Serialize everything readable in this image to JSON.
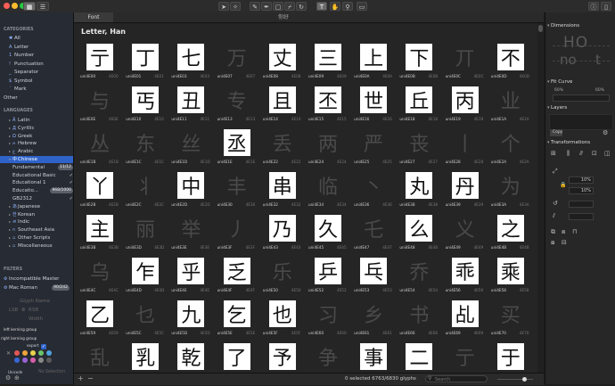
{
  "tabs": [
    {
      "label": "Font"
    },
    {
      "label": "你好"
    }
  ],
  "sidebar": {
    "categories_head": "CATEGORIES",
    "categories": [
      {
        "label": "All",
        "icon": "asterisk"
      },
      {
        "label": "Letter",
        "icon": "A"
      },
      {
        "label": "Number",
        "icon": "1"
      },
      {
        "label": "Punctuation",
        "icon": "!"
      },
      {
        "label": "Separator",
        "icon": "_"
      },
      {
        "label": "Symbol",
        "icon": "$"
      },
      {
        "label": "Mark",
        "icon": "´"
      },
      {
        "label": "Other",
        "icon": ""
      }
    ],
    "languages_head": "LANGUAGES",
    "languages": [
      {
        "label": "Latin",
        "icon": "Ä"
      },
      {
        "label": "Cyrillic",
        "icon": "Д"
      },
      {
        "label": "Greek",
        "icon": "Ω"
      },
      {
        "label": "Hebrew",
        "icon": "א"
      },
      {
        "label": "Arabic",
        "icon": "ع"
      },
      {
        "label": "Chinese",
        "icon": "中"
      }
    ],
    "chinese_sub": [
      {
        "label": "Fundamental",
        "badge": "11/12"
      },
      {
        "label": "Educational Basic",
        "check": "✓"
      },
      {
        "label": "Educational 1",
        "check": "✓"
      },
      {
        "label": "Educatio...",
        "badge": "968/1000"
      },
      {
        "label": "GB2312",
        "check": "✓"
      }
    ],
    "languages2": [
      {
        "label": "Japanese",
        "icon": "あ"
      },
      {
        "label": "Korean",
        "icon": "한"
      },
      {
        "label": "Indic",
        "icon": "अ"
      },
      {
        "label": "Southeast Asia",
        "icon": "ก"
      },
      {
        "label": "Other Scripts",
        "icon": ""
      },
      {
        "label": "Miscellaneous",
        "icon": ""
      }
    ],
    "filters_head": "FILTERS",
    "filters": [
      {
        "label": "Incompatible Master"
      },
      {
        "label": "Mac Roman",
        "badge": "90/242"
      }
    ],
    "glyph_name": "Glyph Name",
    "lsb": "LSB",
    "rsb": "RSB",
    "width": "Width",
    "left_kerning": "left kerning group",
    "right_kerning": "right kerning group",
    "export": "export",
    "unicode": "Unicode",
    "no_selection": "No Selection"
  },
  "main": {
    "title": "Letter, Han",
    "glyphs": [
      {
        "ch": "亍",
        "name": "uni4E00",
        "code": "4E00",
        "drawn": true
      },
      {
        "ch": "丁",
        "name": "uni4E01",
        "code": "4E01",
        "drawn": true
      },
      {
        "ch": "七",
        "name": "uni4E03",
        "code": "4E03",
        "drawn": true
      },
      {
        "ch": "万",
        "name": "uni4E07",
        "code": "4E07",
        "drawn": false
      },
      {
        "ch": "丈",
        "name": "uni4E08",
        "code": "4E08",
        "drawn": true
      },
      {
        "ch": "三",
        "name": "uni4E09",
        "code": "4E09",
        "drawn": true
      },
      {
        "ch": "上",
        "name": "uni4E0A",
        "code": "4E0A",
        "drawn": true
      },
      {
        "ch": "下",
        "name": "uni4E0B",
        "code": "4E0B",
        "drawn": true
      },
      {
        "ch": "丌",
        "name": "uni4E0C",
        "code": "4E0C",
        "drawn": false
      },
      {
        "ch": "不",
        "name": "uni4E0D",
        "code": "4E0D",
        "drawn": true
      },
      {
        "ch": "与",
        "name": "uni4E0E",
        "code": "4E0E",
        "drawn": false
      },
      {
        "ch": "丐",
        "name": "uni4E10",
        "code": "4E10",
        "drawn": true
      },
      {
        "ch": "丑",
        "name": "uni4E11",
        "code": "4E11",
        "drawn": true
      },
      {
        "ch": "专",
        "name": "uni4E13",
        "code": "4E13",
        "drawn": false
      },
      {
        "ch": "且",
        "name": "uni4E14",
        "code": "4E14",
        "drawn": true
      },
      {
        "ch": "丕",
        "name": "uni4E15",
        "code": "4E15",
        "drawn": true
      },
      {
        "ch": "世",
        "name": "uni4E16",
        "code": "4E16",
        "drawn": true
      },
      {
        "ch": "丘",
        "name": "uni4E18",
        "code": "4E18",
        "drawn": true
      },
      {
        "ch": "丙",
        "name": "uni4E19",
        "code": "4E19",
        "drawn": true
      },
      {
        "ch": "业",
        "name": "uni4E1A",
        "code": "4E1A",
        "drawn": false
      },
      {
        "ch": "丛",
        "name": "uni4E1B",
        "code": "4E1B",
        "drawn": false
      },
      {
        "ch": "东",
        "name": "uni4E1C",
        "code": "4E1C",
        "drawn": false
      },
      {
        "ch": "丝",
        "name": "uni4E1D",
        "code": "4E1D",
        "drawn": false
      },
      {
        "ch": "丞",
        "name": "uni4E1E",
        "code": "4E1E",
        "drawn": true
      },
      {
        "ch": "丢",
        "name": "uni4E22",
        "code": "4E22",
        "drawn": false
      },
      {
        "ch": "两",
        "name": "uni4E24",
        "code": "4E24",
        "drawn": false
      },
      {
        "ch": "严",
        "name": "uni4E25",
        "code": "4E25",
        "drawn": false
      },
      {
        "ch": "丧",
        "name": "uni4E27",
        "code": "4E27",
        "drawn": false
      },
      {
        "ch": "丨",
        "name": "uni4E28",
        "code": "4E28",
        "drawn": false
      },
      {
        "ch": "个",
        "name": "uni4E2A",
        "code": "4E2A",
        "drawn": false
      },
      {
        "ch": "丫",
        "name": "uni4E2B",
        "code": "4E2B",
        "drawn": true
      },
      {
        "ch": "丬",
        "name": "uni4E2C",
        "code": "4E2C",
        "drawn": false
      },
      {
        "ch": "中",
        "name": "uni4E2D",
        "code": "4E2D",
        "drawn": true
      },
      {
        "ch": "丰",
        "name": "uni4E30",
        "code": "4E30",
        "drawn": false
      },
      {
        "ch": "串",
        "name": "uni4E32",
        "code": "4E32",
        "drawn": true
      },
      {
        "ch": "临",
        "name": "uni4E34",
        "code": "4E34",
        "drawn": false
      },
      {
        "ch": "丶",
        "name": "uni4E36",
        "code": "4E36",
        "drawn": false
      },
      {
        "ch": "丸",
        "name": "uni4E38",
        "code": "4E38",
        "drawn": true
      },
      {
        "ch": "丹",
        "name": "uni4E39",
        "code": "4E39",
        "drawn": true
      },
      {
        "ch": "为",
        "name": "uni4E3A",
        "code": "4E3A",
        "drawn": false
      },
      {
        "ch": "主",
        "name": "uni4E3B",
        "code": "4E3B",
        "drawn": true
      },
      {
        "ch": "丽",
        "name": "uni4E3D",
        "code": "4E3D",
        "drawn": false
      },
      {
        "ch": "举",
        "name": "uni4E3E",
        "code": "4E3E",
        "drawn": false
      },
      {
        "ch": "丿",
        "name": "uni4E3F",
        "code": "4E3F",
        "drawn": false
      },
      {
        "ch": "乃",
        "name": "uni4E43",
        "code": "4E43",
        "drawn": true
      },
      {
        "ch": "久",
        "name": "uni4E45",
        "code": "4E45",
        "drawn": true
      },
      {
        "ch": "乇",
        "name": "uni4E47",
        "code": "4E47",
        "drawn": false
      },
      {
        "ch": "么",
        "name": "uni4E48",
        "code": "4E48",
        "drawn": true
      },
      {
        "ch": "义",
        "name": "uni4E49",
        "code": "4E49",
        "drawn": false
      },
      {
        "ch": "之",
        "name": "uni4E4B",
        "code": "4E4B",
        "drawn": true
      },
      {
        "ch": "乌",
        "name": "uni4E4C",
        "code": "4E4C",
        "drawn": false
      },
      {
        "ch": "乍",
        "name": "uni4E4D",
        "code": "4E4D",
        "drawn": true
      },
      {
        "ch": "乎",
        "name": "uni4E4E",
        "code": "4E4E",
        "drawn": true
      },
      {
        "ch": "乏",
        "name": "uni4E4F",
        "code": "4E4F",
        "drawn": true
      },
      {
        "ch": "乐",
        "name": "uni4E50",
        "code": "4E50",
        "drawn": false
      },
      {
        "ch": "乒",
        "name": "uni4E52",
        "code": "4E52",
        "drawn": true
      },
      {
        "ch": "乓",
        "name": "uni4E53",
        "code": "4E53",
        "drawn": true
      },
      {
        "ch": "乔",
        "name": "uni4E54",
        "code": "4E54",
        "drawn": false
      },
      {
        "ch": "乖",
        "name": "uni4E56",
        "code": "4E56",
        "drawn": true
      },
      {
        "ch": "乘",
        "name": "uni4E58",
        "code": "4E58",
        "drawn": true
      },
      {
        "ch": "乙",
        "name": "uni4E59",
        "code": "4E59",
        "drawn": true
      },
      {
        "ch": "乜",
        "name": "uni4E5C",
        "code": "4E5C",
        "drawn": false
      },
      {
        "ch": "九",
        "name": "uni4E5D",
        "code": "4E5D",
        "drawn": true
      },
      {
        "ch": "乞",
        "name": "uni4E5E",
        "code": "4E5E",
        "drawn": true
      },
      {
        "ch": "也",
        "name": "uni4E5F",
        "code": "4E5F",
        "drawn": true
      },
      {
        "ch": "习",
        "name": "uni4E60",
        "code": "4E60",
        "drawn": false
      },
      {
        "ch": "乡",
        "name": "uni4E61",
        "code": "4E61",
        "drawn": false
      },
      {
        "ch": "书",
        "name": "uni4E66",
        "code": "4E66",
        "drawn": false
      },
      {
        "ch": "乩",
        "name": "uni4E69",
        "code": "4E69",
        "drawn": true
      },
      {
        "ch": "买",
        "name": "uni4E70",
        "code": "4E70",
        "drawn": false
      },
      {
        "ch": "乱",
        "name": "",
        "code": "",
        "drawn": false
      },
      {
        "ch": "乳",
        "name": "",
        "code": "",
        "drawn": true
      },
      {
        "ch": "乾",
        "name": "",
        "code": "",
        "drawn": true
      },
      {
        "ch": "了",
        "name": "",
        "code": "",
        "drawn": true
      },
      {
        "ch": "予",
        "name": "",
        "code": "",
        "drawn": true
      },
      {
        "ch": "争",
        "name": "",
        "code": "",
        "drawn": false
      },
      {
        "ch": "事",
        "name": "",
        "code": "",
        "drawn": true
      },
      {
        "ch": "二",
        "name": "",
        "code": "",
        "drawn": true
      },
      {
        "ch": "亍",
        "name": "",
        "code": "",
        "drawn": false
      },
      {
        "ch": "于",
        "name": "",
        "code": "",
        "drawn": true
      }
    ]
  },
  "status": {
    "text": "0 selected 6763/6830 glyphs",
    "search_placeholder": "Search",
    "zoom_fraction": 0.75
  },
  "right_panel": {
    "dimensions": "Dimensions",
    "ho": "HO",
    "no": "no",
    "t": "t",
    "fit_curve": "Fit Curve",
    "fit_a": "60%",
    "fit_b": "60%",
    "layers": "Layers",
    "copy": "Copy",
    "transformations": "Transformations",
    "pct1": "10%",
    "pct2": "10%"
  },
  "colors": {
    "accent": "#2f63c9",
    "swatches": [
      "#e25656",
      "#f0a43a",
      "#e8d44d",
      "#6bc46b",
      "#4fa3e0",
      "#3a67d8",
      "#9a63d8",
      "#d85fa8",
      "#8a8a8a",
      "#5a5a5a"
    ]
  }
}
